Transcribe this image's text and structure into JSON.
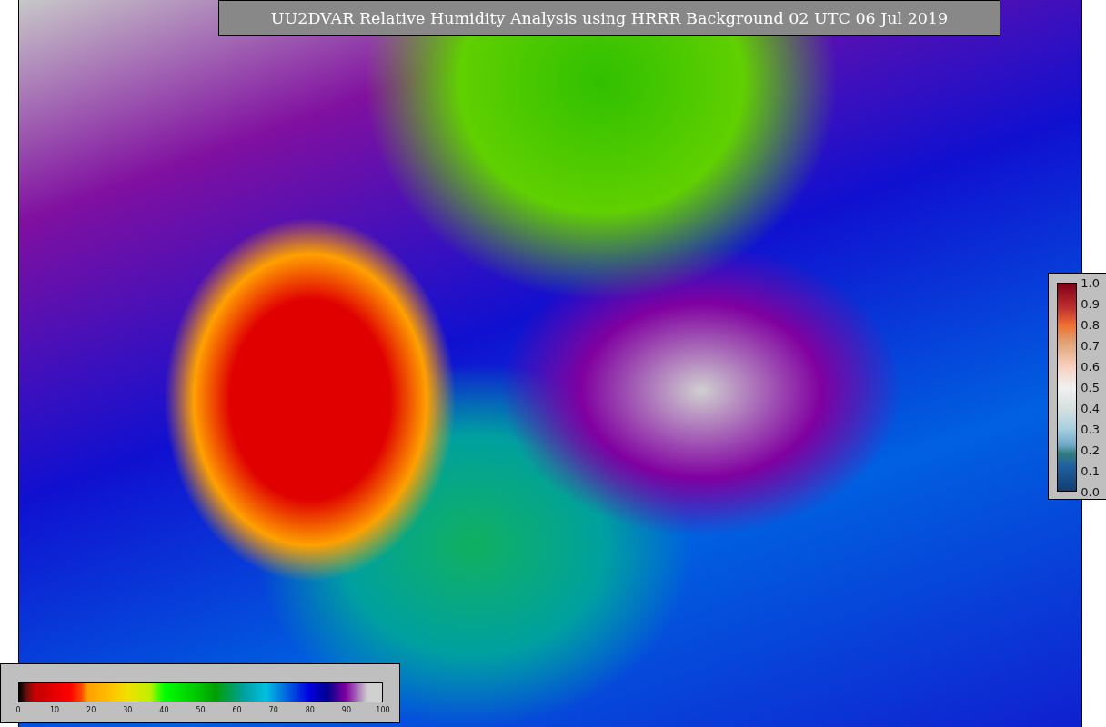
{
  "title": "UU2DVAR Relative Humidity Analysis using HRRR Background 02 UTC 06 Jul 2019",
  "humidity_colorbar": {
    "ticks": [
      "0",
      "10",
      "20",
      "30",
      "40",
      "50",
      "60",
      "70",
      "80",
      "90",
      "100"
    ]
  },
  "ratio_colorbar": {
    "ticks": [
      "1.0",
      "0.9",
      "0.8",
      "0.7",
      "0.6",
      "0.5",
      "0.4",
      "0.3",
      "0.2",
      "0.1",
      "0.0"
    ]
  }
}
